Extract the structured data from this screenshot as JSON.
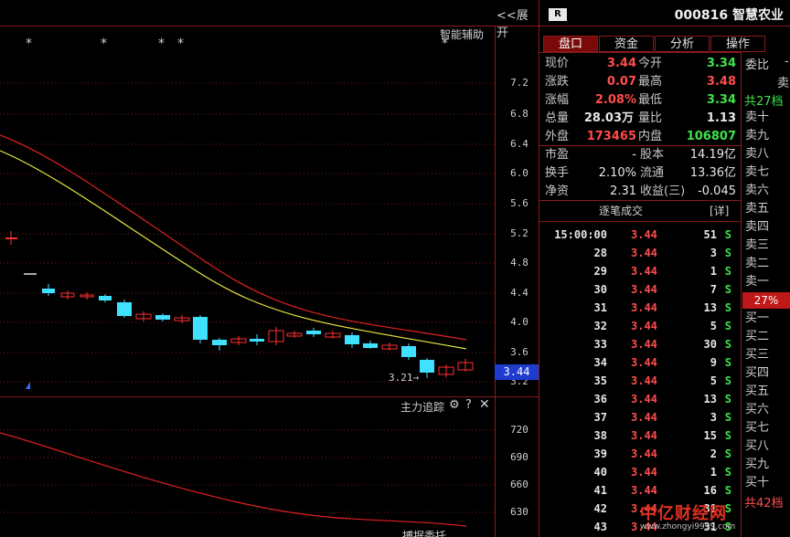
{
  "chart": {
    "expand_label": "<<展开",
    "assistant_label": "智能辅助",
    "stars": [
      "*",
      "*",
      "*",
      "*",
      "*"
    ],
    "y_ticks": [
      "7.2",
      "6.8",
      "6.4",
      "6.0",
      "5.6",
      "5.2",
      "4.8",
      "4.4",
      "4.0",
      "3.6",
      "3.2"
    ],
    "current_price_tag": "3.44",
    "low_marker": "3.21",
    "low_arrow": "→",
    "sub_title": "主力追踪",
    "sub_y_ticks": [
      "720",
      "690",
      "660",
      "630"
    ],
    "bottom_title": "搏据委托"
  },
  "stock": {
    "badge": "R",
    "code_name": "000816 智慧农业"
  },
  "tabs": [
    "盘口",
    "资金",
    "分析",
    "操作"
  ],
  "quote": {
    "rows": [
      {
        "l1": "现价",
        "v1": "3.44",
        "c1": "red",
        "l2": "今开",
        "v2": "3.34",
        "c2": "green"
      },
      {
        "l1": "涨跌",
        "v1": "0.07",
        "c1": "red",
        "l2": "最高",
        "v2": "3.48",
        "c2": "red"
      },
      {
        "l1": "涨幅",
        "v1": "2.08%",
        "c1": "red",
        "l2": "最低",
        "v2": "3.34",
        "c2": "green"
      },
      {
        "l1": "总量",
        "v1": "28.03万",
        "c1": "white",
        "l2": "量比",
        "v2": "1.13",
        "c2": "white"
      },
      {
        "l1": "外盘",
        "v1": "173465",
        "c1": "red",
        "l2": "内盘",
        "v2": "106807",
        "c2": "green"
      }
    ],
    "rows2": [
      {
        "l1": "市盈",
        "v1": "-",
        "l2": "股本",
        "v2": "14.19亿"
      },
      {
        "l1": "换手",
        "v1": "2.10%",
        "l2": "流通",
        "v2": "13.36亿"
      },
      {
        "l1": "净资",
        "v1": "2.31",
        "l2": "收益(三)",
        "v2": "-0.045"
      }
    ]
  },
  "ticks": {
    "title": "逐笔成交",
    "detail": "[详]",
    "rows": [
      {
        "t": "15:00:00",
        "p": "3.44",
        "v": "51",
        "s": "S"
      },
      {
        "t": "28",
        "p": "3.44",
        "v": "3",
        "s": "S"
      },
      {
        "t": "29",
        "p": "3.44",
        "v": "1",
        "s": "S"
      },
      {
        "t": "30",
        "p": "3.44",
        "v": "7",
        "s": "S"
      },
      {
        "t": "31",
        "p": "3.44",
        "v": "13",
        "s": "S"
      },
      {
        "t": "32",
        "p": "3.44",
        "v": "5",
        "s": "S"
      },
      {
        "t": "33",
        "p": "3.44",
        "v": "30",
        "s": "S"
      },
      {
        "t": "34",
        "p": "3.44",
        "v": "9",
        "s": "S"
      },
      {
        "t": "35",
        "p": "3.44",
        "v": "5",
        "s": "S"
      },
      {
        "t": "36",
        "p": "3.44",
        "v": "13",
        "s": "S"
      },
      {
        "t": "37",
        "p": "3.44",
        "v": "3",
        "s": "S"
      },
      {
        "t": "38",
        "p": "3.44",
        "v": "15",
        "s": "S"
      },
      {
        "t": "39",
        "p": "3.44",
        "v": "2",
        "s": "S"
      },
      {
        "t": "40",
        "p": "3.44",
        "v": "1",
        "s": "S"
      },
      {
        "t": "41",
        "p": "3.44",
        "v": "16",
        "s": "S"
      },
      {
        "t": "42",
        "p": "3.44",
        "v": "31",
        "s": "S"
      },
      {
        "t": "43",
        "p": "3.44",
        "v": "31",
        "s": "S"
      }
    ]
  },
  "orderbook": {
    "ratio_label": "委比",
    "ratio_dash": "-",
    "top_char": "卖",
    "sell_count": "共27档",
    "sells": [
      "卖十",
      "卖九",
      "卖八",
      "卖七",
      "卖六",
      "卖五",
      "卖四",
      "卖三",
      "卖二",
      "卖一"
    ],
    "mid_pct": "27%",
    "buys": [
      "买一",
      "买二",
      "买三",
      "买四",
      "买五",
      "买六",
      "买七",
      "买八",
      "买九",
      "买十"
    ],
    "buy_count": "共42档"
  },
  "watermark": {
    "brand": "中亿财经网",
    "url": "www.zhongyi9999.com"
  },
  "icons": {
    "settings": "gear-icon",
    "help": "help-icon",
    "close": "close-icon"
  }
}
